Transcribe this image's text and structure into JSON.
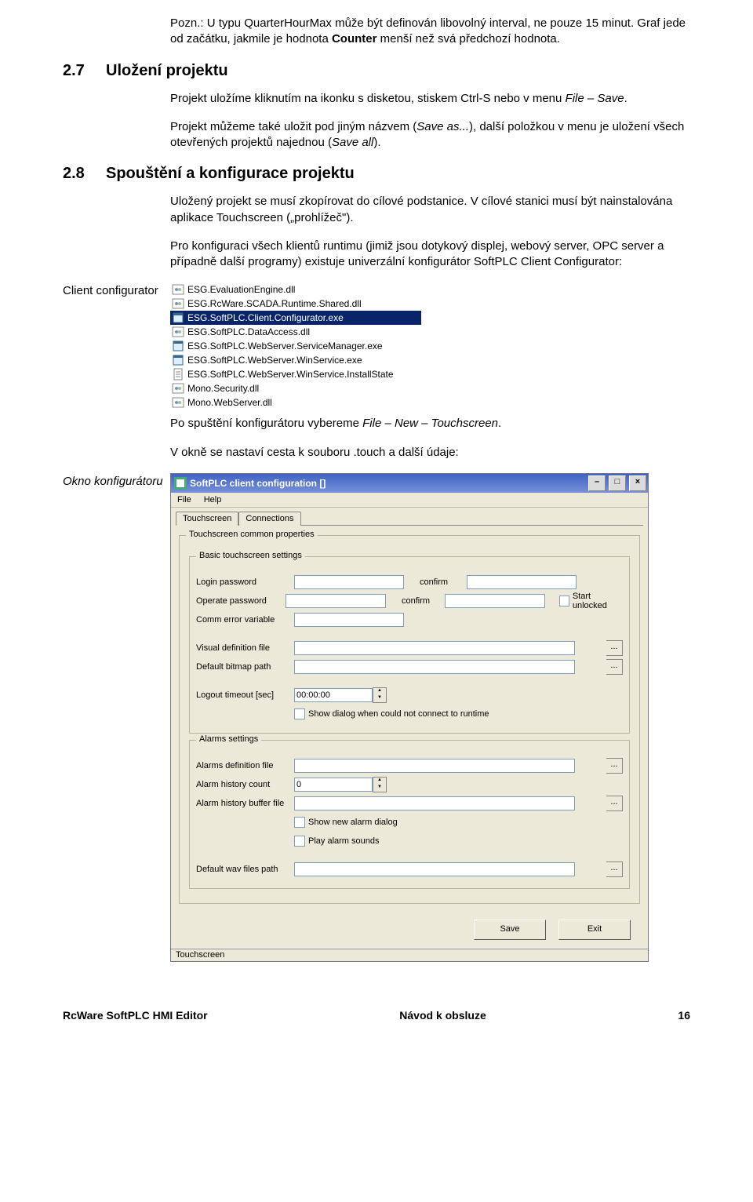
{
  "para1_a": "Pozn.: U typu QuarterHourMax může být definován libovolný interval, ne pouze 15 minut. Graf jede od začátku, jakmile je hodnota ",
  "para1_b": "Counter",
  "para1_c": " menší než svá předchozí hodnota.",
  "sec27_num": "2.7",
  "sec27_title": "Uložení projektu",
  "para2_a": "Projekt uložíme kliknutím na ikonku s disketou, stiskem Ctrl-S nebo v menu ",
  "para2_b": "File – Save",
  "para2_c": ".",
  "para3_a": "Projekt můžeme také uložit pod jiným názvem (",
  "para3_b": "Save as...",
  "para3_c": "), další položkou v menu je uložení všech otevřených projektů najednou (",
  "para3_d": "Save all",
  "para3_e": ").",
  "sec28_num": "2.8",
  "sec28_title": "Spouštění a konfigurace projektu",
  "para4": "Uložený projekt se musí zkopírovat do cílové podstanice. V cílové stanici musí být nainstalována aplikace Touchscreen („prohlížeč\").",
  "para5": "Pro konfiguraci všech klientů runtimu (jimiž jsou dotykový displej, webový server, OPC server a případně další programy) existuje univerzální konfigurátor SoftPLC Client Configurator:",
  "side_label1": "Client configurator",
  "side_label2": "Okno konfigurátoru",
  "filelist": [
    {
      "icon": "dll",
      "name": "ESG.EvaluationEngine.dll",
      "sel": false
    },
    {
      "icon": "dll",
      "name": "ESG.RcWare.SCADA.Runtime.Shared.dll",
      "sel": false
    },
    {
      "icon": "exe",
      "name": "ESG.SoftPLC.Client.Configurator.exe",
      "sel": true
    },
    {
      "icon": "dll",
      "name": "ESG.SoftPLC.DataAccess.dll",
      "sel": false
    },
    {
      "icon": "exe",
      "name": "ESG.SoftPLC.WebServer.ServiceManager.exe",
      "sel": false
    },
    {
      "icon": "exe",
      "name": "ESG.SoftPLC.WebServer.WinService.exe",
      "sel": false
    },
    {
      "icon": "file",
      "name": "ESG.SoftPLC.WebServer.WinService.InstallState",
      "sel": false
    },
    {
      "icon": "dll",
      "name": "Mono.Security.dll",
      "sel": false
    },
    {
      "icon": "dll",
      "name": "Mono.WebServer.dll",
      "sel": false
    }
  ],
  "para6_a": "Po spuštění konfigurátoru vybereme ",
  "para6_b": "File – New – Touchscreen",
  "para6_c": ".",
  "para7": "V okně se nastaví cesta k souboru .touch a další údaje:",
  "cfg": {
    "title": "SoftPLC client configuration []",
    "menu_file": "File",
    "menu_help": "Help",
    "tab_touch": "Touchscreen",
    "tab_conn": "Connections",
    "grp_common": "Touchscreen common properties",
    "grp_basic": "Basic touchscreen settings",
    "lbl_login": "Login password",
    "lbl_operate": "Operate password",
    "lbl_confirm": "confirm",
    "chk_start_unlocked": "Start unlocked",
    "lbl_commerr": "Comm error variable",
    "lbl_visdef": "Visual definition file",
    "lbl_bitmap": "Default bitmap path",
    "lbl_logout": "Logout timeout [sec]",
    "val_logout": "00:00:00",
    "chk_showdialog": "Show dialog when could not connect to runtime",
    "grp_alarms": "Alarms settings",
    "lbl_alarmdef": "Alarms definition file",
    "lbl_alarmcount": "Alarm history count",
    "val_alarmcount": "0",
    "lbl_alarmbuf": "Alarm history buffer file",
    "chk_shownewalarm": "Show new alarm dialog",
    "chk_playsounds": "Play alarm sounds",
    "lbl_wavpath": "Default wav files path",
    "btn_save": "Save",
    "btn_exit": "Exit",
    "status": "Touchscreen",
    "close": "×",
    "max": "□",
    "min": "–",
    "dots": "..."
  },
  "footer_left": "RcWare SoftPLC HMI Editor",
  "footer_center": "Návod k obsluze",
  "footer_right": "16"
}
